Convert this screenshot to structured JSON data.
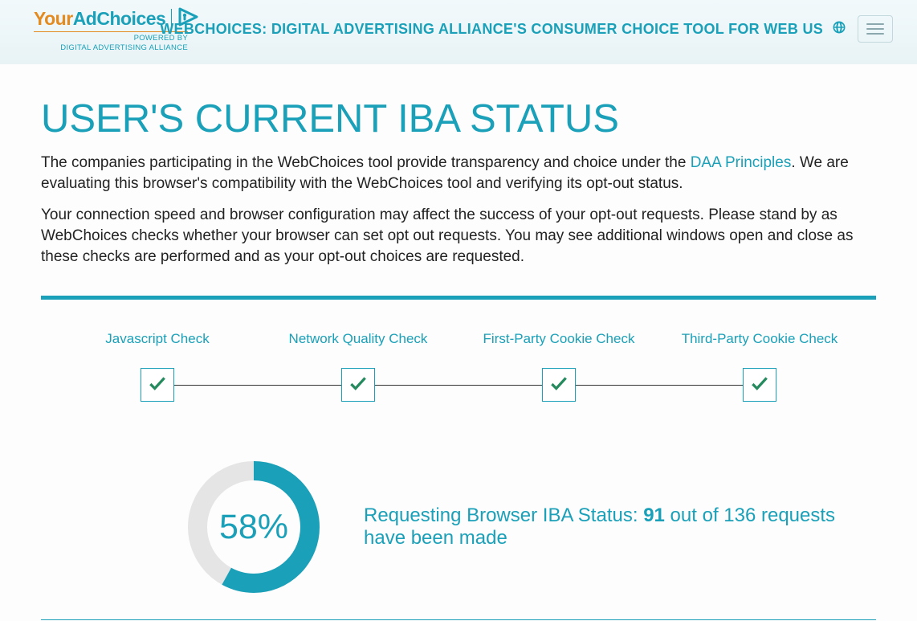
{
  "header": {
    "logo_your": "Your",
    "logo_ad": "AdChoices",
    "logo_sub1": "POWERED BY",
    "logo_sub2": "DIGITAL ADVERTISING ALLIANCE",
    "title": "WEBCHOICES: DIGITAL ADVERTISING ALLIANCE'S CONSUMER CHOICE TOOL FOR WEB US"
  },
  "page": {
    "title": "USER'S CURRENT IBA STATUS",
    "desc1a": "The companies participating in the WebChoices tool provide transparency and choice under the ",
    "desc1_link": "DAA Principles",
    "desc1b": ". We are evaluating this browser's compatibility with the WebChoices tool and verifying its opt-out status.",
    "desc2": "Your connection speed and browser configuration may affect the success of your opt-out requests. Please stand by as WebChoices checks whether your browser can set opt out requests. You may see additional windows open and close as these checks are performed and as your opt-out choices are requested."
  },
  "checks": [
    {
      "label": "Javascript Check"
    },
    {
      "label": "Network Quality Check"
    },
    {
      "label": "First-Party Cookie Check"
    },
    {
      "label": "Third-Party Cookie Check"
    }
  ],
  "progress": {
    "percent": 58,
    "percent_text": "58%",
    "status_prefix": "Requesting Browser IBA Status: ",
    "done": 91,
    "total": 136,
    "status_suffix_a": " out of ",
    "status_suffix_b": " requests have been made"
  },
  "colors": {
    "accent": "#1aa0b8",
    "orange": "#e38b21",
    "check_green": "#258a5d"
  }
}
